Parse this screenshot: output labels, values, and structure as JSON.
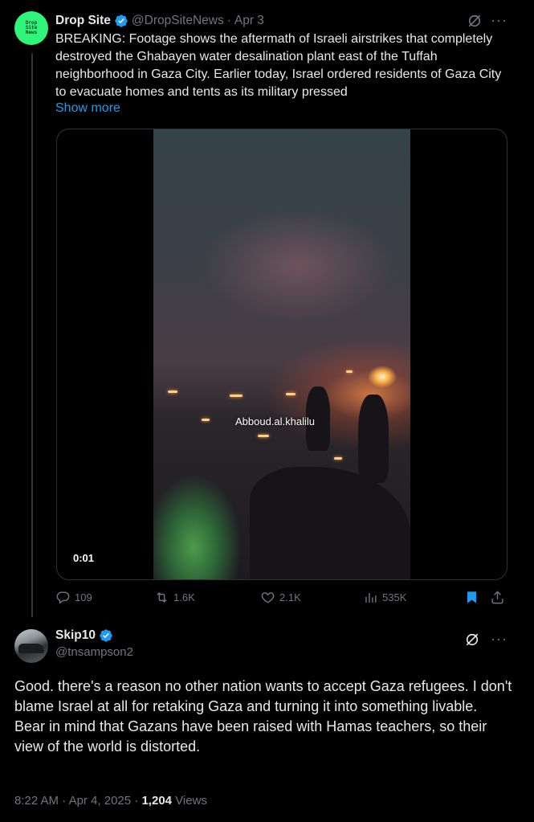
{
  "tweet1": {
    "avatar_text": "Drop Site News",
    "name": "Drop Site",
    "handle": "@DropSiteNews",
    "separator": "·",
    "date": "Apr 3",
    "text": "BREAKING: Footage shows the aftermath of Israeli airstrikes that completely destroyed the Ghabayen water desalination plant east of the Tuffah neighborhood in Gaza City. Earlier today, Israel ordered residents of Gaza City to evacuate homes and tents as its military pressed",
    "show_more": "Show more",
    "video": {
      "watermark": "Abboud.al.khalilu",
      "timestamp": "0:01"
    },
    "actions": {
      "replies": "109",
      "reposts": "1.6K",
      "likes": "2.1K",
      "views": "535K"
    }
  },
  "tweet2": {
    "name": "Skip10",
    "handle": "@tnsampson2",
    "text_line1": "Good.  there's a reason no other nation wants to accept Gaza refugees.  I don't blame Israel at all for retaking Gaza and turning it into something livable.",
    "text_line2": "Bear in mind that Gazans have been raised with Hamas teachers, so their view of the world is distorted.",
    "time": "8:22 AM",
    "sep1": "·",
    "date": "Apr 4, 2025",
    "sep2": "·",
    "views_count": "1,204",
    "views_label": "Views"
  },
  "colors": {
    "background": "#000000",
    "text": "#e7e9ea",
    "secondary": "#71767b",
    "accent": "#1d9bf0",
    "verified": "#1d9bf0",
    "avatar_brand": "#2ff57a"
  },
  "icons": {
    "verified": "verified-badge-icon",
    "grok": "grok-icon",
    "more": "more-icon",
    "reply": "reply-icon",
    "repost": "repost-icon",
    "like": "like-icon",
    "views": "views-icon",
    "bookmark": "bookmark-icon",
    "share": "share-icon"
  }
}
